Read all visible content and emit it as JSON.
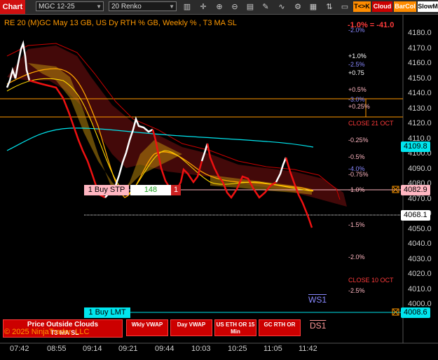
{
  "toolbar": {
    "tab_label": "Chart",
    "instrument": "MGC 12-25",
    "bar_type": "20 Renko",
    "btn_tk": "T<>K",
    "btn_cloud": "Cloud",
    "btn_barcol": "BarCol",
    "btn_slowma": "SlowM"
  },
  "header": {
    "title": "RE 20  (M)GC May 13 GB, US Dy RTH % GB, Weekly % , T3 MA SL",
    "pct_top": "-1.0% = -41.0",
    "pct_top2": "-2.0%"
  },
  "yaxis": {
    "ticks": [
      "4180.0",
      "4170.0",
      "4160.0",
      "4150.0",
      "4140.0",
      "4130.0",
      "4120.0",
      "4110.0",
      "4100.0",
      "4090.0",
      "4080.0",
      "4070.0",
      "4060.0",
      "4050.0",
      "4040.0",
      "4030.0",
      "4020.0",
      "4010.0",
      "4000.0"
    ]
  },
  "xaxis": {
    "ticks": [
      "07:42",
      "08:55",
      "09:14",
      "09:21",
      "09:44",
      "10:03",
      "10:25",
      "11:05",
      "11:42"
    ]
  },
  "price_labels": {
    "cyan_ma": "4109.8",
    "last": "4082.9",
    "cursor": "4068.1",
    "buy_lmt": "4008.6"
  },
  "level_texts": {
    "p1": "+1.0%",
    "m25a": "-2.5%",
    "p075": "+0.75",
    "p05": "+0.5%",
    "m3": "-3.0%",
    "p025": "+0.25%",
    "close21": "CLOSE 21 OCT",
    "m025": "-0.25%",
    "m05": "-0.5%",
    "m40": "-4.0%",
    "m075": "-0.75%",
    "m10": "-1.0%",
    "m15": "-1.5%",
    "m20": "-2.0%",
    "close10": "CLOSE 10 OCT",
    "m25b": "-2.5%",
    "ws1": "WS1",
    "ds1": "DS1"
  },
  "orders": {
    "stp_label": "1 Buy STP",
    "stp_qty": "148",
    "stp_close": "1",
    "lmt_label": "1 Buy LMT"
  },
  "buttons": {
    "price_outside_clouds": "Price Outside Clouds",
    "t3ma": "T3 MA SL",
    "copyright": "© 2025 NinjaTrader, LLC",
    "wkly_vwap": "Wkly VWAP",
    "day_vwap": "Day VWAP",
    "us_eth": "US ETH OR 15 Min",
    "gc_rth": "GC RTH OR"
  },
  "colors": {
    "accent_red": "#cc0000",
    "cyan": "#00e5ee",
    "orange": "#ff9900",
    "buy_pink": "#ffb6c1"
  }
}
